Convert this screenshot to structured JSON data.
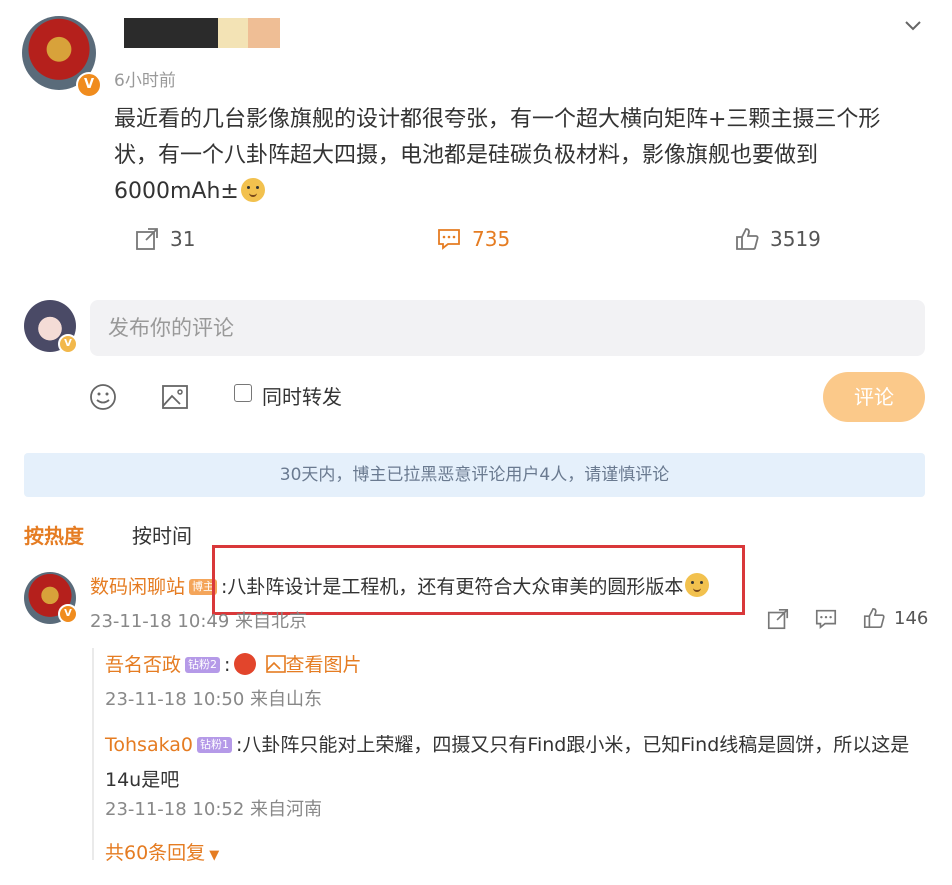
{
  "post": {
    "time": "6小时前",
    "text": "最近看的几台影像旗舰的设计都很夸张，有一个超大横向矩阵+三颗主摄三个形状，有一个八卦阵超大四摄，电池都是硅碳负极材料，影像旗舰也要做到6000mAh±",
    "badge": "V",
    "actions": {
      "repost": "31",
      "comment": "735",
      "like": "3519"
    }
  },
  "composer": {
    "placeholder": "发布你的评论",
    "sync_label": "同时转发",
    "submit_label": "评论"
  },
  "notice": "30天内，博主已拉黑恶意评论用户4人，请谨慎评论",
  "sort": {
    "hot": "按热度",
    "time": "按时间"
  },
  "comment": {
    "name": "数码闲聊站",
    "tag": "博主",
    "text": ":八卦阵设计是工程机，还有更符合大众审美的圆形版本",
    "meta": "23-11-18 10:49 来自北京",
    "likes": "146"
  },
  "replies": [
    {
      "name": "吾名否政",
      "tag": "钻粉2",
      "text": ":",
      "image_link": "查看图片",
      "meta": "23-11-18 10:50 来自山东"
    },
    {
      "name": "Tohsaka0",
      "tag": "钻粉1",
      "text": ":八卦阵只能对上荣耀，四摄又只有Find跟小米，已知Find线稿是圆饼，所以这是14u是吧",
      "meta": "23-11-18 10:52 来自河南"
    }
  ],
  "more_replies": "共60条回复",
  "colors": {
    "accent": "#e57c22",
    "highlight_box": "#d9383a",
    "notice_bg": "#e5f0fb"
  }
}
